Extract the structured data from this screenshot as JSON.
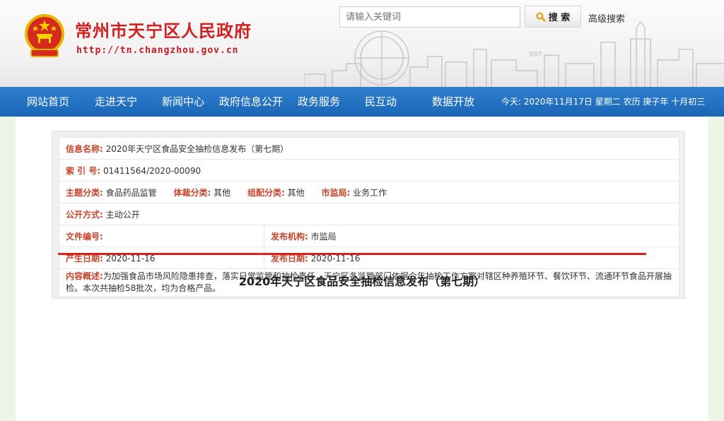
{
  "header": {
    "site_title": "常州市天宁区人民政府",
    "site_url": "http://tn.changzhou.gov.cn",
    "search_placeholder": "请输入关键词",
    "search_button": "搜 索",
    "advanced_search": "高级搜索",
    "skyline_text": "BRT"
  },
  "nav": {
    "items": [
      "网站首页",
      "走进天宁",
      "新闻中心",
      "政府信息公开",
      "政务服务",
      "民互动",
      "数据开放"
    ],
    "date_text": "今天: 2020年11月17日 星期二 农历 庚子年 十月初三"
  },
  "info": {
    "name_label": "信息名称:",
    "name_value": "2020年天宁区食品安全抽检信息发布（第七期）",
    "index_label": "索 引 号:",
    "index_value": "01411564/2020-00090",
    "topic_label": "主题分类:",
    "topic_value": "食品药品监管",
    "genre_label": "体裁分类:",
    "genre_value": "其他",
    "org_label": "组配分类:",
    "org_value": "其他",
    "bureau_label": "市监局:",
    "bureau_value": "业务工作",
    "open_label": "公开方式:",
    "open_value": "主动公开",
    "docno_label": "文件编号:",
    "docno_value": "",
    "publisher_label": "发布机构:",
    "publisher_value": "市监局",
    "created_label": "产生日期:",
    "created_value": "2020-11-16",
    "published_label": "发布日期:",
    "published_value": "2020-11-16",
    "summary_label": "内容概述:",
    "summary_value": "为加强食品市场风险隐患排查，落实日常监管和抽检责任，天宁区各监管部门依据今年抽检工作方案对辖区种养殖环节、餐饮环节、流通环节食品开展抽检。本次共抽检58批次，均为合格产品。"
  },
  "article": {
    "title": "2020年天宁区食品安全抽检信息发布（第七期）"
  }
}
